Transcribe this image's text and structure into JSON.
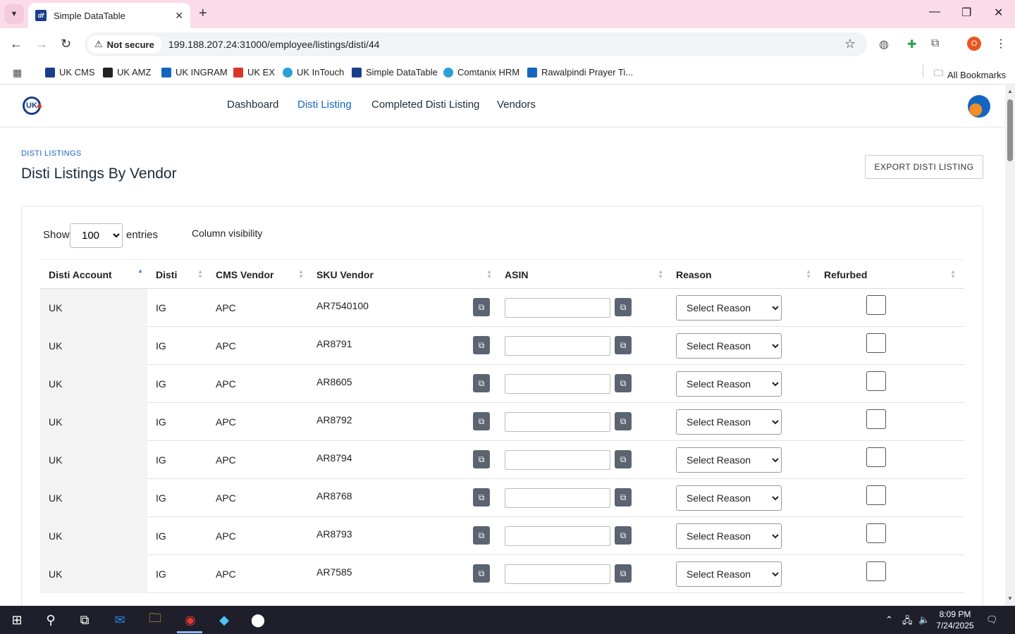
{
  "browser": {
    "tab_title": "Simple DataTable",
    "tab_favicon": "df",
    "security_label": "Not secure",
    "url": "199.188.207.24:31000/employee/listings/disti/44",
    "profile_initial": "O",
    "bookmarks": [
      {
        "label": "UK CMS",
        "color": "#1a3e8c"
      },
      {
        "label": "UK AMZ",
        "color": "#222222"
      },
      {
        "label": "UK INGRAM",
        "color": "#1565c0"
      },
      {
        "label": "UK EX",
        "color": "#d9352b"
      },
      {
        "label": "UK InTouch",
        "color": "#2aa1d6"
      },
      {
        "label": "Simple DataTable",
        "color": "#1a3e8c"
      },
      {
        "label": "Comtanix HRM",
        "color": "#2aa1d6"
      },
      {
        "label": "Rawalpindi Prayer Ti...",
        "color": "#1565c0"
      }
    ],
    "all_bookmarks": "All Bookmarks"
  },
  "nav": {
    "logo": "UK",
    "links": [
      "Dashboard",
      "Disti Listing",
      "Completed Disti Listing",
      "Vendors"
    ],
    "active_index": 1
  },
  "page": {
    "breadcrumb": "DISTI LISTINGS",
    "title": "Disti Listings By Vendor",
    "export_label": "EXPORT DISTI LISTING",
    "show_label": "Show",
    "entries_value": "100",
    "entries_label": "entries",
    "column_visibility": "Column visibility"
  },
  "table": {
    "columns": [
      "Disti Account",
      "Disti",
      "CMS Vendor",
      "SKU Vendor",
      "ASIN",
      "Reason",
      "Refurbed"
    ],
    "reason_placeholder": "Select Reason",
    "rows": [
      {
        "account": "UK",
        "disti": "IG",
        "vendor": "APC",
        "sku": "AR7540100"
      },
      {
        "account": "UK",
        "disti": "IG",
        "vendor": "APC",
        "sku": "AR8791"
      },
      {
        "account": "UK",
        "disti": "IG",
        "vendor": "APC",
        "sku": "AR8605"
      },
      {
        "account": "UK",
        "disti": "IG",
        "vendor": "APC",
        "sku": "AR8792"
      },
      {
        "account": "UK",
        "disti": "IG",
        "vendor": "APC",
        "sku": "AR8794"
      },
      {
        "account": "UK",
        "disti": "IG",
        "vendor": "APC",
        "sku": "AR8768"
      },
      {
        "account": "UK",
        "disti": "IG",
        "vendor": "APC",
        "sku": "AR8793"
      },
      {
        "account": "UK",
        "disti": "IG",
        "vendor": "APC",
        "sku": "AR7585"
      }
    ]
  },
  "taskbar": {
    "time": "8:09 PM",
    "date": "7/24/2025"
  }
}
